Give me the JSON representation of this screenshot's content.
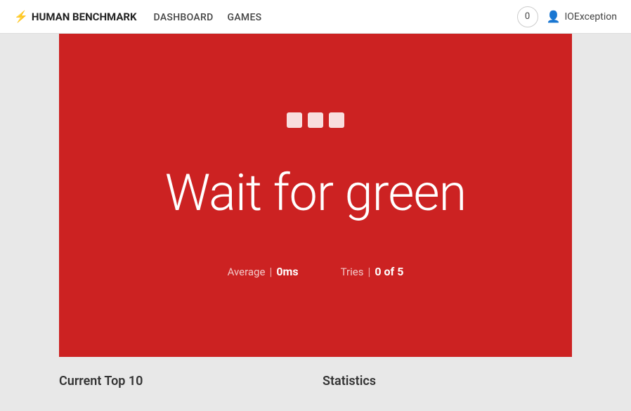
{
  "nav": {
    "brand": "HUMAN BENCHMARK",
    "bolt": "⚡",
    "links": [
      "DASHBOARD",
      "GAMES"
    ],
    "score": "0",
    "user": "IOException"
  },
  "game": {
    "dots": [
      "●",
      "●",
      "●"
    ],
    "title": "Wait for green",
    "stats": {
      "average_label": "Average",
      "average_separator": "|",
      "average_value": "0ms",
      "tries_label": "Tries",
      "tries_separator": "|",
      "tries_value": "0 of 5"
    }
  },
  "bottom": {
    "top10_label": "Current Top 10",
    "statistics_label": "Statistics"
  }
}
